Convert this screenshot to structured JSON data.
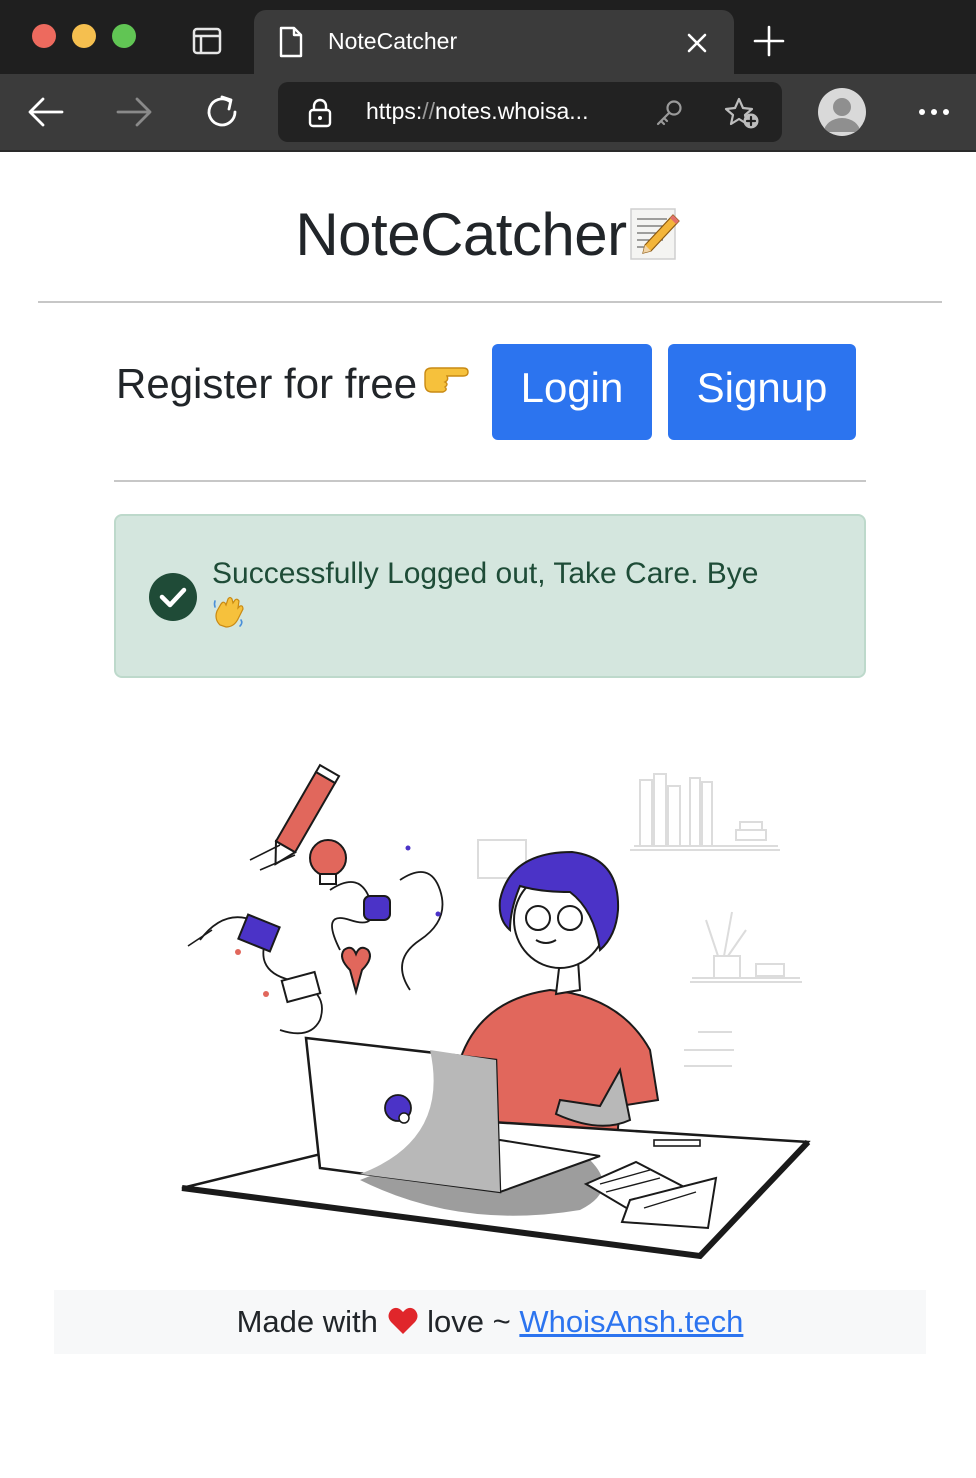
{
  "browser": {
    "tab_title": "NoteCatcher",
    "url_scheme": "https:",
    "url_sep": "//",
    "url_rest": "notes.whoisa..."
  },
  "page": {
    "title": "NoteCatcher",
    "register_text": "Register for free",
    "login_label": "Login",
    "signup_label": "Signup",
    "alert_text": "Successfully Logged out, Take Care. Bye",
    "footer_prefix": "Made with",
    "footer_middle": "love ~",
    "footer_link": "WhoisAnsh.tech"
  },
  "colors": {
    "primary": "#2c74ef",
    "alert_bg": "#d4e6de",
    "alert_text": "#1e4c37"
  },
  "icons": {
    "title_emoji": "memo-icon",
    "register_emoji": "pointing-right-icon",
    "alert_emoji": "waving-hand-icon",
    "footer_emoji": "heart-icon"
  }
}
